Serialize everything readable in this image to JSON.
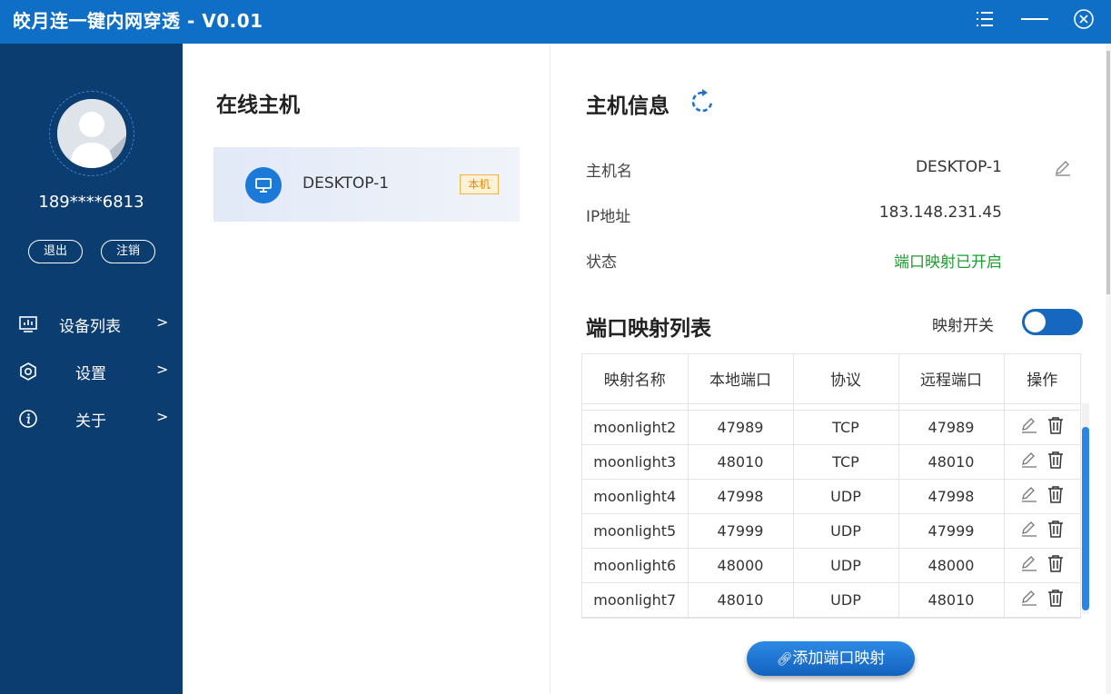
{
  "window": {
    "title": "皎月连一键内网穿透 - V0.01",
    "colors": {
      "titlebar": "#0f6fc6",
      "sidebar": "#0b3d70",
      "accent": "#1567c0",
      "status_green": "#1aa02f"
    }
  },
  "sidebar": {
    "phone": "189****6813",
    "logout_label": "退出",
    "cancel_label": "注销",
    "items": [
      {
        "label": "设备列表",
        "arrow": ">",
        "icon": "monitor-chart-icon"
      },
      {
        "label": "设置",
        "arrow": ">",
        "icon": "hexagon-settings-icon"
      },
      {
        "label": "关于",
        "arrow": ">",
        "icon": "info-icon"
      }
    ]
  },
  "online_hosts": {
    "title": "在线主机",
    "hosts": [
      {
        "name": "DESKTOP-1",
        "badge": "本机",
        "icon": "monitor-icon"
      }
    ]
  },
  "host_info": {
    "title": "主机信息",
    "hostname_label": "主机名",
    "hostname_value": "DESKTOP-1",
    "ip_label": "IP地址",
    "ip_value": "183.148.231.45",
    "status_label": "状态",
    "status_value": "端口映射已开启"
  },
  "mapping": {
    "title": "端口映射列表",
    "toggle_label": "映射开关",
    "toggle_on": true,
    "columns": [
      "映射名称",
      "本地端口",
      "协议",
      "远程端口",
      "操作"
    ],
    "rows": [
      {
        "name": "moonlight2",
        "local": "47989",
        "proto": "TCP",
        "remote": "47989"
      },
      {
        "name": "moonlight3",
        "local": "48010",
        "proto": "TCP",
        "remote": "48010"
      },
      {
        "name": "moonlight4",
        "local": "47998",
        "proto": "UDP",
        "remote": "47998"
      },
      {
        "name": "moonlight5",
        "local": "47999",
        "proto": "UDP",
        "remote": "47999"
      },
      {
        "name": "moonlight6",
        "local": "48000",
        "proto": "UDP",
        "remote": "48000"
      },
      {
        "name": "moonlight7",
        "local": "48010",
        "proto": "UDP",
        "remote": "48010"
      }
    ],
    "add_label": "添加端口映射"
  }
}
